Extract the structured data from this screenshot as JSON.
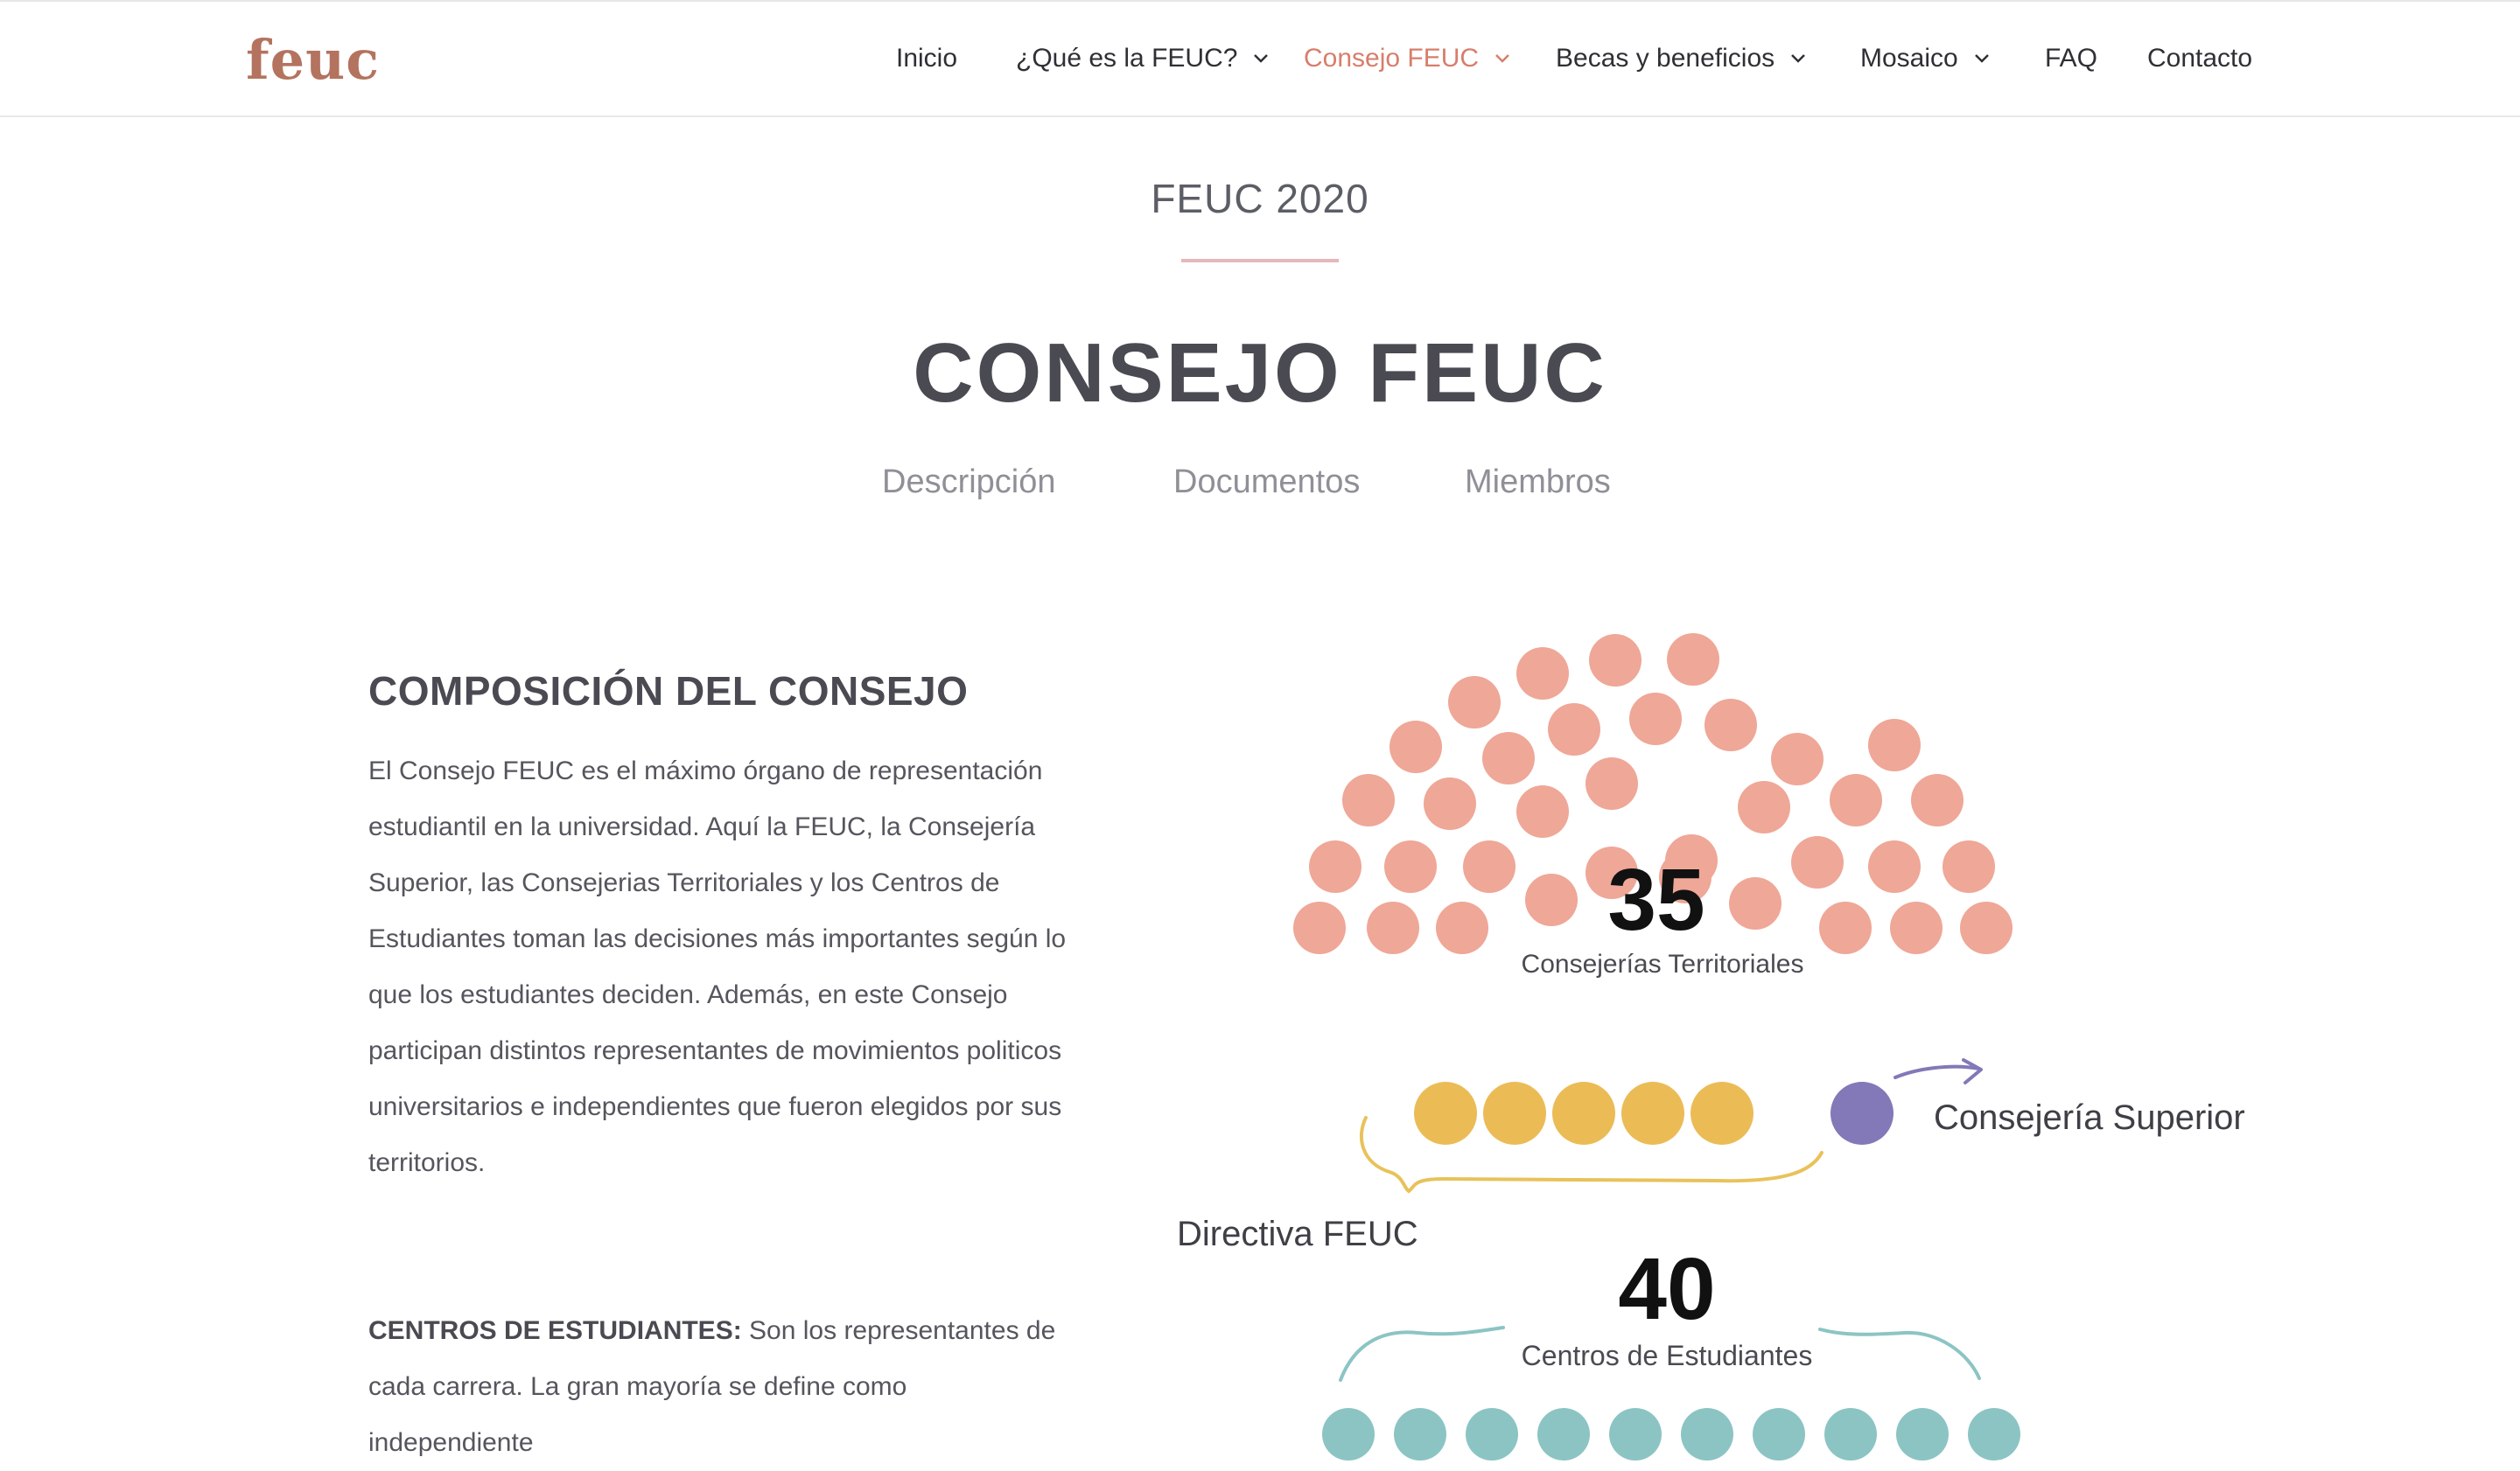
{
  "header": {
    "logo": "feuc",
    "nav": [
      {
        "label": "Inicio",
        "dropdown": false,
        "active": false
      },
      {
        "label": "¿Qué es la FEUC?",
        "dropdown": true,
        "active": false
      },
      {
        "label": "Consejo FEUC",
        "dropdown": true,
        "active": true
      },
      {
        "label": "Becas y beneficios",
        "dropdown": true,
        "active": false
      },
      {
        "label": "Mosaico",
        "dropdown": true,
        "active": false
      },
      {
        "label": "FAQ",
        "dropdown": false,
        "active": false
      },
      {
        "label": "Contacto",
        "dropdown": false,
        "active": false
      }
    ]
  },
  "hero": {
    "eyebrow": "FEUC 2020",
    "title": "CONSEJO FEUC",
    "tabs": [
      "Descripción",
      "Documentos",
      "Miembros"
    ]
  },
  "content": {
    "section_title": "COMPOSICIÓN DEL CONSEJO",
    "paragraph_1": "El Consejo FEUC es el máximo órgano de representación estudiantil en la universidad. Aquí la FEUC, la Consejería Superior, las Consejerias Territoriales y los Centros de Estudiantes toman las decisiones más importantes según lo que los estudiantes deciden. Además, en este Consejo participan distintos representantes de movimientos politicos universitarios e independientes que fueron elegidos por sus territorios.",
    "centros_label": "CENTROS DE ESTUDIANTES:",
    "centros_text": "Son los representantes de cada carrera. La gran mayoría se define como independiente"
  },
  "composition": {
    "territoriales": {
      "count": "35",
      "label": "Consejerías Territoriales",
      "seats": 35,
      "color": "#efa797"
    },
    "directiva": {
      "label": "Directiva FEUC",
      "seats": 5,
      "color": "#ebbc56"
    },
    "superior": {
      "label": "Consejería Superior",
      "seats": 1,
      "color": "#8378b8"
    },
    "centros": {
      "count": "40",
      "label": "Centros de  Estudiantes",
      "seats": 40,
      "color": "#8cc4c4"
    },
    "colors": {
      "brace_yellow": "#e8c25a",
      "arrow_purple": "#8378b8",
      "brace_teal": "#8cc4c4"
    }
  }
}
